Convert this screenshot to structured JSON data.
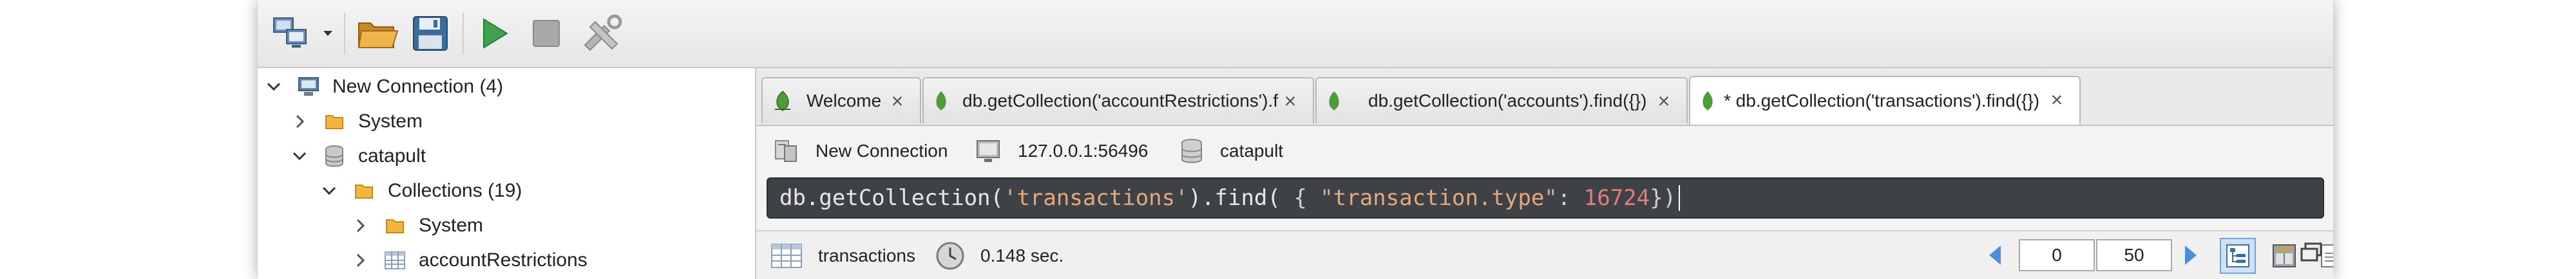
{
  "toolbar": {
    "buttons": [
      {
        "icon": "connect-icon"
      },
      {
        "icon": "dropdown-icon"
      },
      {
        "icon": "open-folder-icon"
      },
      {
        "icon": "save-icon"
      },
      {
        "icon": "run-icon"
      },
      {
        "icon": "stop-icon"
      },
      {
        "icon": "tools-icon"
      }
    ]
  },
  "tree": {
    "connection": "New Connection (4)",
    "system_db": "System",
    "database": "catapult",
    "collections": "Collections (19)",
    "collections_system": "System",
    "collection_item": "accountRestrictions"
  },
  "tabs": [
    {
      "label": "Welcome"
    },
    {
      "label": "db.getCollection('accountRestrictions').f"
    },
    {
      "label": "db.getCollection('accounts').find({})"
    },
    {
      "label": "* db.getCollection('transactions').find({})"
    }
  ],
  "info_bar": {
    "connection": "New Connection",
    "address": "127.0.0.1:56496",
    "database": "catapult"
  },
  "query": {
    "prefix": "db.getCollection(",
    "collection": "'transactions'",
    "middle": ").find(",
    "open": " { ",
    "key": "\"transaction.type\"",
    "colon": ": ",
    "number": "16724",
    "close": "})"
  },
  "status": {
    "collection": "transactions",
    "time": "0.148 sec.",
    "skip": "0",
    "limit": "50"
  },
  "colors": {
    "query_bg": "#3e4246",
    "accent": "#4a90d9",
    "mongo_green": "#4f9a3a"
  }
}
